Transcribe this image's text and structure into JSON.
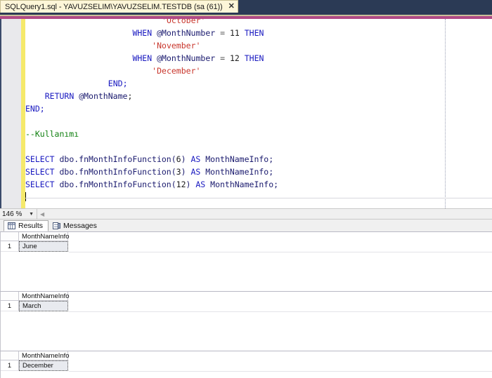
{
  "window": {
    "tab_title": "SQLQuery1.sql - YAVUZSELIM\\YAVUZSELIM.TESTDB (sa (61))",
    "tab_close_label": "✕"
  },
  "editor": {
    "zoom_level": "146 %",
    "zoom_caret": "▼",
    "hscroll_left": "◀",
    "lines": [
      {
        "indent": 28,
        "tokens": [
          {
            "t": "'October'",
            "c": "str"
          }
        ]
      },
      {
        "indent": 22,
        "tokens": [
          {
            "t": "WHEN ",
            "c": "kw"
          },
          {
            "t": "@MonthNumber",
            "c": "var"
          },
          {
            "t": " = ",
            "c": "op"
          },
          {
            "t": "11",
            "c": "num"
          },
          {
            "t": " ",
            "c": "plain"
          },
          {
            "t": "THEN",
            "c": "kw"
          }
        ]
      },
      {
        "indent": 26,
        "tokens": [
          {
            "t": "'November'",
            "c": "str"
          }
        ]
      },
      {
        "indent": 22,
        "tokens": [
          {
            "t": "WHEN ",
            "c": "kw"
          },
          {
            "t": "@MonthNumber",
            "c": "var"
          },
          {
            "t": " = ",
            "c": "op"
          },
          {
            "t": "12",
            "c": "num"
          },
          {
            "t": " ",
            "c": "plain"
          },
          {
            "t": "THEN",
            "c": "kw"
          }
        ]
      },
      {
        "indent": 26,
        "tokens": [
          {
            "t": "'December'",
            "c": "str"
          }
        ]
      },
      {
        "indent": 17,
        "tokens": [
          {
            "t": "END;",
            "c": "kw"
          }
        ]
      },
      {
        "indent": 4,
        "tokens": [
          {
            "t": "RETURN ",
            "c": "kw"
          },
          {
            "t": "@MonthName",
            "c": "var"
          },
          {
            "t": ";",
            "c": "plain"
          }
        ]
      },
      {
        "indent": 0,
        "tokens": [
          {
            "t": "END;",
            "c": "kw"
          }
        ]
      },
      {
        "indent": 0,
        "tokens": []
      },
      {
        "indent": 0,
        "tokens": [
          {
            "t": "--Kullanımı",
            "c": "cmt"
          }
        ]
      },
      {
        "indent": 0,
        "tokens": []
      },
      {
        "indent": 0,
        "tokens": [
          {
            "t": "SELECT",
            "c": "kw"
          },
          {
            "t": " dbo.fnMonthInfoFunction(",
            "c": "var"
          },
          {
            "t": "6",
            "c": "num"
          },
          {
            "t": ") ",
            "c": "var"
          },
          {
            "t": "AS",
            "c": "kw"
          },
          {
            "t": " MonthNameInfo;",
            "c": "var"
          }
        ]
      },
      {
        "indent": 0,
        "tokens": [
          {
            "t": "SELECT",
            "c": "kw"
          },
          {
            "t": " dbo.fnMonthInfoFunction(",
            "c": "var"
          },
          {
            "t": "3",
            "c": "num"
          },
          {
            "t": ") ",
            "c": "var"
          },
          {
            "t": "AS",
            "c": "kw"
          },
          {
            "t": " MonthNameInfo;",
            "c": "var"
          }
        ]
      },
      {
        "indent": 0,
        "tokens": [
          {
            "t": "SELECT",
            "c": "kw"
          },
          {
            "t": " dbo.fnMonthInfoFunction(",
            "c": "var"
          },
          {
            "t": "12",
            "c": "num"
          },
          {
            "t": ") ",
            "c": "var"
          },
          {
            "t": "AS",
            "c": "kw"
          },
          {
            "t": " MonthNameInfo;",
            "c": "var"
          }
        ]
      }
    ]
  },
  "results": {
    "tabs": [
      {
        "label": "Results",
        "icon": "grid-icon",
        "active": true
      },
      {
        "label": "Messages",
        "icon": "message-icon",
        "active": false
      }
    ],
    "grids": [
      {
        "column": "MonthNameInfo",
        "row_number": "1",
        "value": "June"
      },
      {
        "column": "MonthNameInfo",
        "row_number": "1",
        "value": "March"
      },
      {
        "column": "MonthNameInfo",
        "row_number": "1",
        "value": "December"
      }
    ]
  },
  "colors": {
    "chrome_navy": "#2b3a55",
    "accent_magenta": "#b14a86",
    "accent_tan": "#cbbf9a",
    "tab_cream": "#fdf6d8",
    "change_bar_yellow": "#f5e96b",
    "keyword_blue": "#1818c0",
    "string_red": "#c8352b",
    "comment_green": "#108010"
  }
}
